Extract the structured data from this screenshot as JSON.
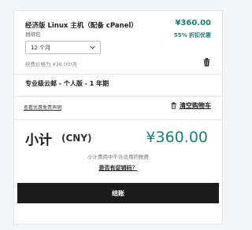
{
  "cart": {
    "item": {
      "name": "经济版 Linux 主机（配备 cPanel）",
      "subtitle": "捆绑包",
      "price": "¥360.00",
      "discount": "55% 折扣优惠",
      "term_selected": "12 个月",
      "renewal": "续费价格为 ¥36.00/月"
    },
    "addon": "专业级云邮 - 个人版 - 1 年期",
    "promo_disclaimer_link": "查看优惠免责声明",
    "clear_cart_label": "清空购物车"
  },
  "summary": {
    "subtotal_label": "小计",
    "currency": "(CNY)",
    "subtotal_value": "¥360.00",
    "tax_note": "小计费用中不含适用的税费",
    "promo_question": "是否有促销码？",
    "checkout_label": "结账"
  },
  "colors": {
    "accent": "#1d7f74",
    "button": "#1b1b1b"
  },
  "icons": {
    "remove_item": "trash-icon",
    "clear_cart": "trash-icon",
    "term_dropdown": "chevron-down-icon"
  }
}
